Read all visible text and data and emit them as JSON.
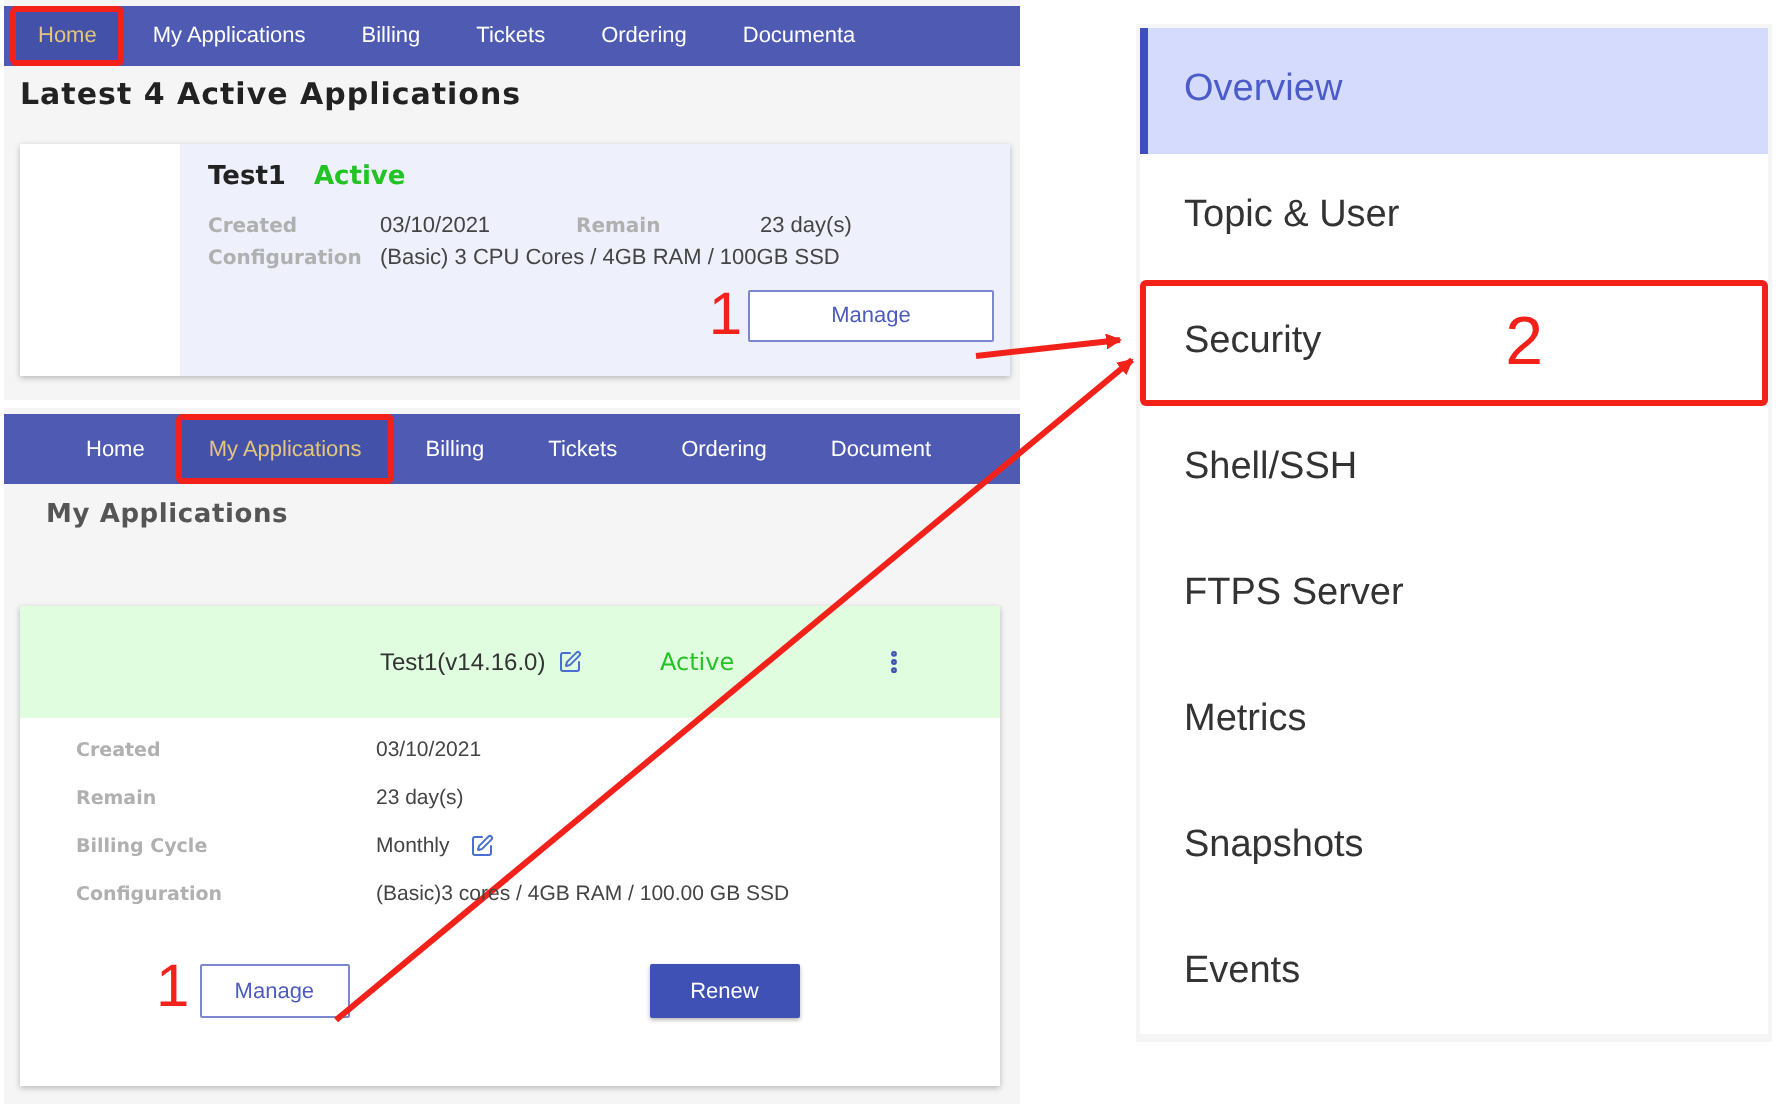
{
  "home_view": {
    "nav": [
      {
        "label": "Home",
        "selected": true,
        "highlighted": true
      },
      {
        "label": "My Applications",
        "selected": false,
        "highlighted": false
      },
      {
        "label": "Billing",
        "selected": false,
        "highlighted": false
      },
      {
        "label": "Tickets",
        "selected": false,
        "highlighted": false
      },
      {
        "label": "Ordering",
        "selected": false,
        "highlighted": false
      },
      {
        "label": "Documenta",
        "selected": false,
        "highlighted": false
      }
    ],
    "heading": "Latest 4 Active Applications",
    "card": {
      "name": "Test1",
      "status": "Active",
      "details": [
        {
          "label": "Created",
          "value": "03/10/2021"
        },
        {
          "label": "Remain",
          "value": "23 day(s)"
        },
        {
          "label": "Configuration",
          "value": "(Basic) 3 CPU Cores / 4GB RAM / 100GB SSD"
        }
      ],
      "step": "1",
      "button": "Manage"
    }
  },
  "applications_view": {
    "nav": [
      {
        "label": "Home",
        "selected": false,
        "highlighted": false
      },
      {
        "label": "My Applications",
        "selected": true,
        "highlighted": true
      },
      {
        "label": "Billing",
        "selected": false,
        "highlighted": false
      },
      {
        "label": "Tickets",
        "selected": false,
        "highlighted": false
      },
      {
        "label": "Ordering",
        "selected": false,
        "highlighted": false
      },
      {
        "label": "Document",
        "selected": false,
        "highlighted": false
      }
    ],
    "heading": "My Applications",
    "card": {
      "title": "Test1(v14.16.0)",
      "status": "Active",
      "details": [
        {
          "label": "Created",
          "value": "03/10/2021",
          "editable": false
        },
        {
          "label": "Remain",
          "value": "23 day(s)",
          "editable": false
        },
        {
          "label": "Billing Cycle",
          "value": "Monthly",
          "editable": true
        },
        {
          "label": "Configuration",
          "value": "(Basic)3 cores / 4GB RAM / 100.00 GB SSD",
          "editable": false
        }
      ],
      "step": "1",
      "buttons": [
        {
          "label": "Manage",
          "kind": "outline"
        },
        {
          "label": "Renew",
          "kind": "filled"
        }
      ]
    }
  },
  "app_menu": {
    "items": [
      {
        "label": "Overview",
        "selected": true,
        "highlighted": false
      },
      {
        "label": "Topic & User",
        "selected": false,
        "highlighted": false
      },
      {
        "label": "Security",
        "selected": false,
        "highlighted": true,
        "step": "2"
      },
      {
        "label": "Shell/SSH",
        "selected": false,
        "highlighted": false
      },
      {
        "label": "FTPS Server",
        "selected": false,
        "highlighted": false
      },
      {
        "label": "Metrics",
        "selected": false,
        "highlighted": false
      },
      {
        "label": "Snapshots",
        "selected": false,
        "highlighted": false
      },
      {
        "label": "Events",
        "selected": false,
        "highlighted": false
      }
    ]
  }
}
